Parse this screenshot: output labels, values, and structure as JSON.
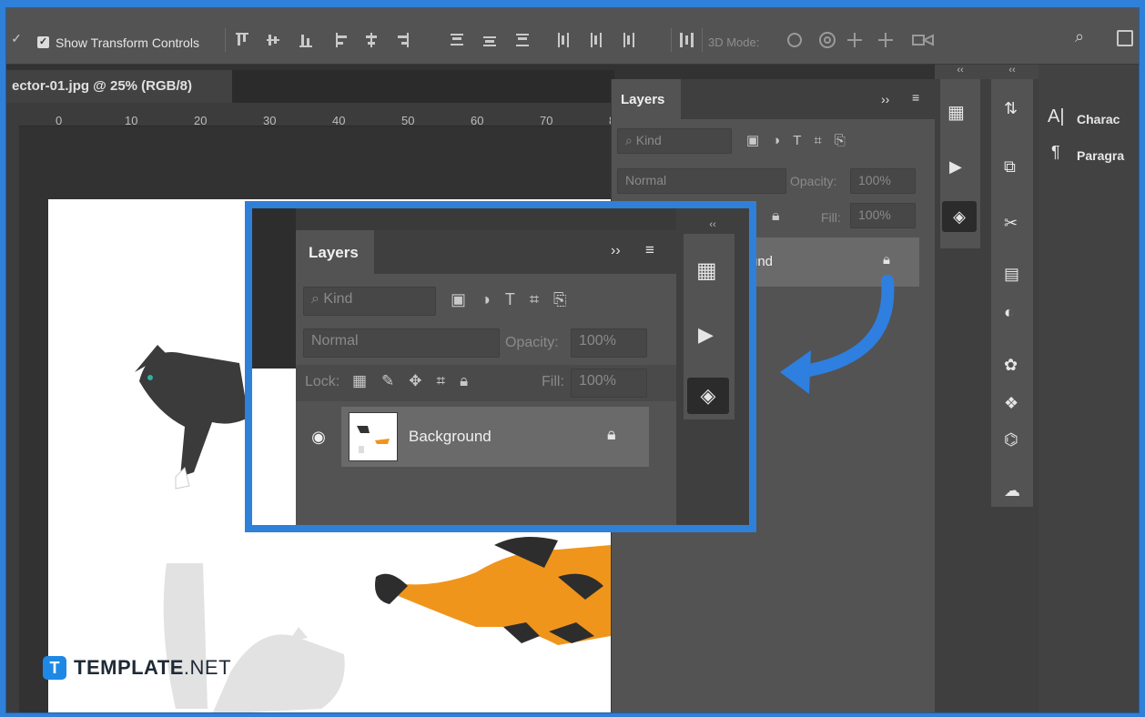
{
  "options_bar": {
    "show_transform_controls": "Show Transform Controls",
    "mode_3d_label": "3D Mode:",
    "search_icon": "magnifier-icon"
  },
  "document_tab": {
    "title": "ector-01.jpg @ 25% (RGB/8)"
  },
  "ruler": {
    "ticks": [
      "0",
      "10",
      "20",
      "30",
      "40",
      "50",
      "60",
      "70",
      "8"
    ]
  },
  "layers_panel": {
    "title": "Layers",
    "collapse": "››",
    "collapse_arrows": "‹‹",
    "kind_filter": "Kind",
    "blend_mode": "Normal",
    "opacity_label": "Opacity:",
    "opacity_value": "100%",
    "lock_label": "Lock:",
    "fill_label": "Fill:",
    "fill_value": "100%",
    "layer_name": "Background",
    "layer_name_partial": "und"
  },
  "right_panels": {
    "character_label": "Charac",
    "paragraph_label": "Paragra"
  },
  "watermark": {
    "logo_letter": "T",
    "name_bold": "TEMPLATE",
    "name_rest": ".NET"
  },
  "colors": {
    "highlight_border": "#2f80d8",
    "arrow": "#2e7fe0",
    "panel_bg": "#535353",
    "app_bg": "#323232"
  }
}
